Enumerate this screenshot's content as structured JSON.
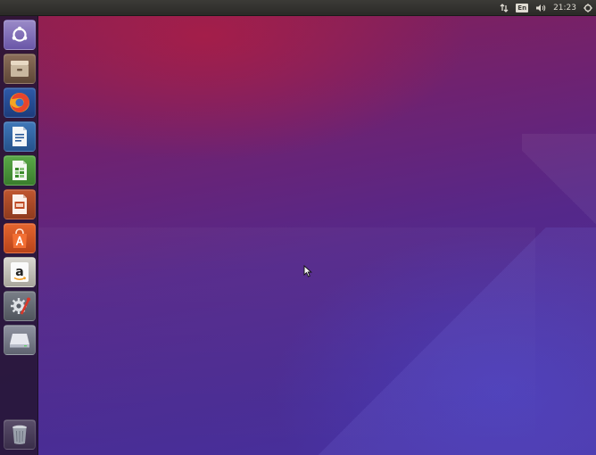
{
  "panel": {
    "keyboard_layout": "En",
    "clock": "21:23",
    "icons": {
      "network": "network-arrows-icon",
      "keyboard": "keyboard-layout-icon",
      "volume": "volume-icon",
      "system": "gear-icon"
    }
  },
  "launcher": {
    "items": [
      {
        "name": "dash-home",
        "icon": "ubuntu-logo-icon"
      },
      {
        "name": "files",
        "icon": "file-cabinet-icon"
      },
      {
        "name": "firefox",
        "icon": "firefox-icon"
      },
      {
        "name": "libreoffice-writer",
        "icon": "writer-document-icon"
      },
      {
        "name": "libreoffice-calc",
        "icon": "calc-spreadsheet-icon"
      },
      {
        "name": "libreoffice-impress",
        "icon": "impress-presentation-icon"
      },
      {
        "name": "software-center",
        "icon": "shopping-bag-icon"
      },
      {
        "name": "amazon",
        "icon": "amazon-icon"
      },
      {
        "name": "system-settings",
        "icon": "settings-gear-wrench-icon"
      },
      {
        "name": "drive",
        "icon": "drive-icon"
      },
      {
        "name": "trash",
        "icon": "trash-icon"
      }
    ]
  },
  "colors": {
    "panel_bg": "#3c3b37",
    "panel_text": "#dfdbd2",
    "launcher_bg": "#261634",
    "wallpaper_top": "#8c1f4f",
    "wallpaper_bottom": "#4631a0"
  }
}
